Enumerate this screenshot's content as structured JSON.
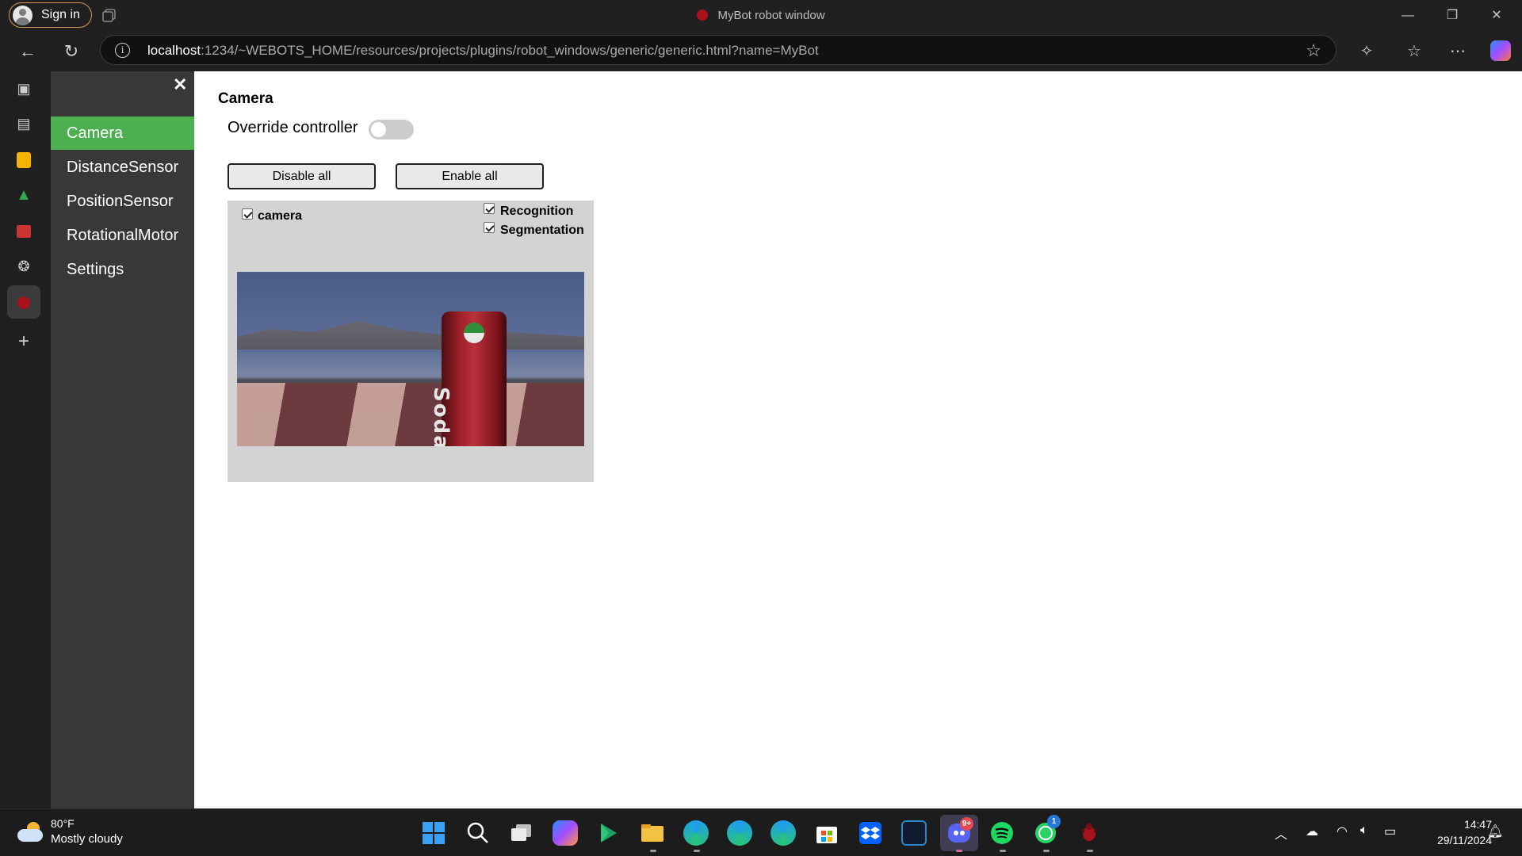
{
  "titlebar": {
    "sign_in": "Sign in",
    "window_title": "MyBot robot window",
    "minimize": "—",
    "restore": "❐",
    "close": "✕"
  },
  "navbar": {
    "url_host": "localhost",
    "url_rest": ":1234/~WEBOTS_HOME/resources/projects/plugins/robot_windows/generic/generic.html?name=MyBot",
    "info_glyph": "i"
  },
  "robot_window": {
    "close_glyph": "✕",
    "menu": [
      {
        "label": "Camera",
        "active": true
      },
      {
        "label": "DistanceSensor",
        "active": false
      },
      {
        "label": "PositionSensor",
        "active": false
      },
      {
        "label": "RotationalMotor",
        "active": false
      },
      {
        "label": "Settings",
        "active": false
      }
    ],
    "heading": "Camera",
    "override_label": "Override controller",
    "override_enabled": false,
    "disable_all": "Disable all",
    "enable_all": "Enable all",
    "device": {
      "name": "camera",
      "enabled": true,
      "recognition_label": "Recognition",
      "recognition_checked": true,
      "segmentation_label": "Segmentation",
      "segmentation_checked": true,
      "image_text": "Soda"
    }
  },
  "taskbar": {
    "temperature": "80°F",
    "condition": "Mostly cloudy",
    "time": "14:47",
    "date": "29/11/2024",
    "discord_badge": "9+",
    "whatsapp_badge": "1"
  },
  "colors": {
    "active_menu": "#4caf50",
    "menu_bg": "#383838",
    "panel_bg": "#d3d3d3"
  }
}
